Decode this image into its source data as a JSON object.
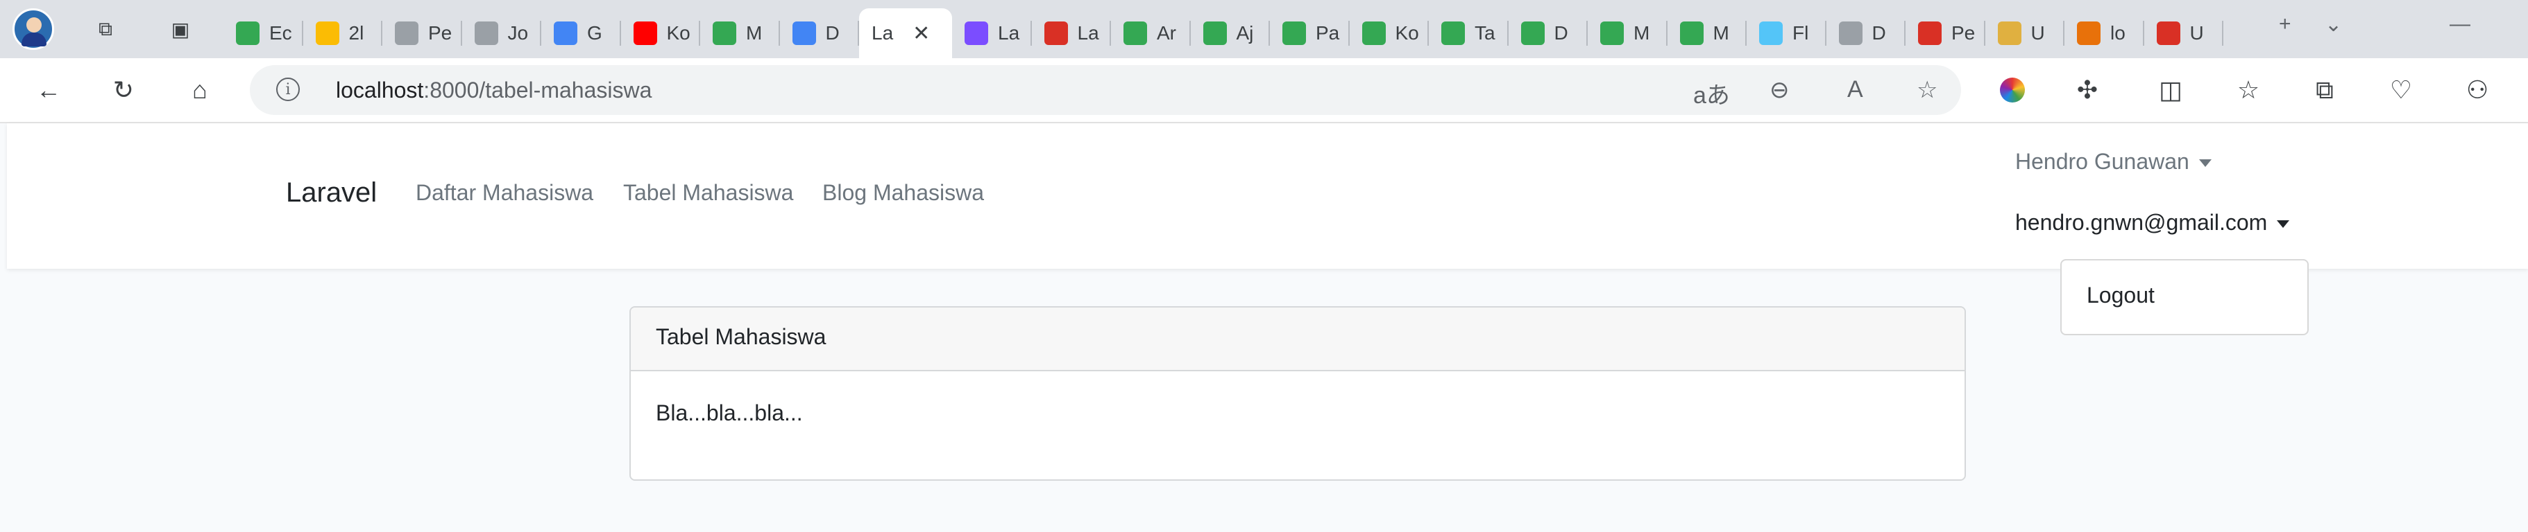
{
  "browser": {
    "tabs": [
      {
        "label": "Ec",
        "fav": "#34a853"
      },
      {
        "label": "2l",
        "fav": "#fbbc04"
      },
      {
        "label": "Pe",
        "fav": "#9aa0a6"
      },
      {
        "label": "Jo",
        "fav": "#9aa0a6"
      },
      {
        "label": "G",
        "fav": "#4285f4"
      },
      {
        "label": "Ko",
        "fav": "#ff0000"
      },
      {
        "label": "M",
        "fav": "#34a853"
      },
      {
        "label": "D",
        "fav": "#4285f4"
      },
      {
        "label": "La",
        "fav": "#ffffff",
        "active": true
      },
      {
        "label": "La",
        "fav": "#7b4dff"
      },
      {
        "label": "La",
        "fav": "#d93025"
      },
      {
        "label": "Ar",
        "fav": "#34a853"
      },
      {
        "label": "Aj",
        "fav": "#34a853"
      },
      {
        "label": "Pa",
        "fav": "#34a853"
      },
      {
        "label": "Ko",
        "fav": "#34a853"
      },
      {
        "label": "Ta",
        "fav": "#34a853"
      },
      {
        "label": "D",
        "fav": "#34a853"
      },
      {
        "label": "M",
        "fav": "#34a853"
      },
      {
        "label": "M",
        "fav": "#34a853"
      },
      {
        "label": "Fl",
        "fav": "#54c5f8"
      },
      {
        "label": "D",
        "fav": "#9aa0a6"
      },
      {
        "label": "Pe",
        "fav": "#d93025"
      },
      {
        "label": "U",
        "fav": "#e0b040"
      },
      {
        "label": "lo",
        "fav": "#e8710a"
      },
      {
        "label": "U",
        "fav": "#d93025"
      }
    ],
    "address": {
      "host": "localhost",
      "path": ":8000/tabel-mahasiswa"
    }
  },
  "navbar": {
    "brand": "Laravel",
    "links": [
      "Daftar Mahasiswa",
      "Tabel Mahasiswa",
      "Blog Mahasiswa"
    ],
    "user_name": "Hendro Gunawan",
    "user_email": "hendro.gnwn@gmail.com",
    "dropdown_item": "Logout"
  },
  "card": {
    "header": "Tabel Mahasiswa",
    "body": "Bla...bla...bla..."
  }
}
